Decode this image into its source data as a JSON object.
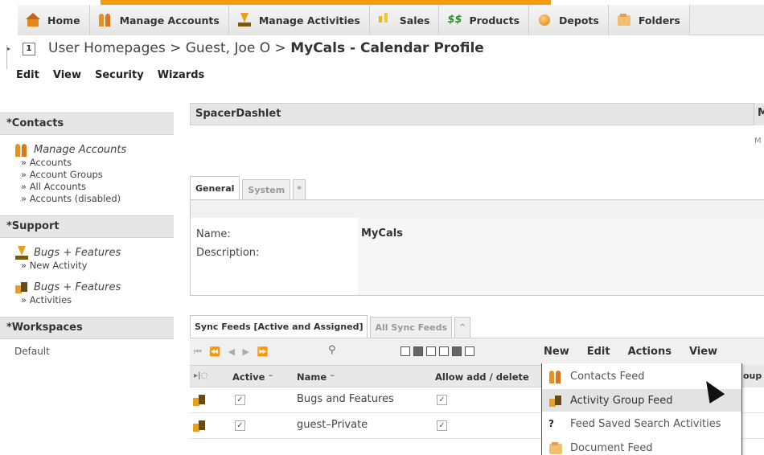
{
  "main_tabs": [
    {
      "label": "Home",
      "icon": "home-icon"
    },
    {
      "label": "Manage Accounts",
      "icon": "accounts-icon"
    },
    {
      "label": "Manage Activities",
      "icon": "activities-icon"
    },
    {
      "label": "Sales",
      "icon": "sales-icon"
    },
    {
      "label": "Products",
      "icon": "products-icon"
    },
    {
      "label": "Depots",
      "icon": "depots-icon"
    },
    {
      "label": "Folders",
      "icon": "folders-icon"
    }
  ],
  "breadcrumb": {
    "part1": "User Homepages",
    "sep1": " > ",
    "part2": "Guest, Joe O",
    "sep2": " > ",
    "current": "MyCals - Calendar Profile"
  },
  "module_menu": [
    "Edit",
    "View",
    "Security",
    "Wizards"
  ],
  "sidebar": {
    "contacts": {
      "header": "*Contacts",
      "title": "Manage Accounts",
      "links": [
        "» Accounts",
        "» Account Groups",
        "» All Accounts",
        "» Accounts (disabled)"
      ]
    },
    "support": {
      "header": "*Support",
      "entry1_title": "Bugs + Features",
      "entry1_link": "» New Activity",
      "entry2_title": "Bugs + Features",
      "entry2_link": "» Activities"
    },
    "workspaces": {
      "header": "*Workspaces",
      "default": "Default"
    }
  },
  "spacer": {
    "title": "SpacerDashlet",
    "right_header": "M",
    "right_text": "M"
  },
  "detail_tabs": [
    "General",
    "System",
    "*"
  ],
  "detail": {
    "name_label": "Name:",
    "name_value": "MyCals",
    "description_label": "Description:"
  },
  "sync_tabs": [
    "Sync Feeds [Active and Assigned]",
    "All Sync Feeds",
    "^"
  ],
  "pager": "⏮ ⏪ ◀ ▶ ⏩",
  "toolbar_menu": [
    "New",
    "Edit",
    "Actions",
    "View"
  ],
  "table": {
    "col_active": "Active ⁻",
    "col_name": "Name ⁻",
    "col_allow": "Allow add / delete",
    "col_right": "oup",
    "rows": [
      {
        "name": "Bugs and Features",
        "active": "✓",
        "allow": "✓"
      },
      {
        "name": "guest–Private",
        "active": "✓",
        "allow": "✓"
      }
    ]
  },
  "dropdown": {
    "items": [
      "Contacts Feed",
      "Activity Group Feed",
      "Feed Saved Search Activities",
      "Document Feed"
    ],
    "highlighted_index": 1
  }
}
